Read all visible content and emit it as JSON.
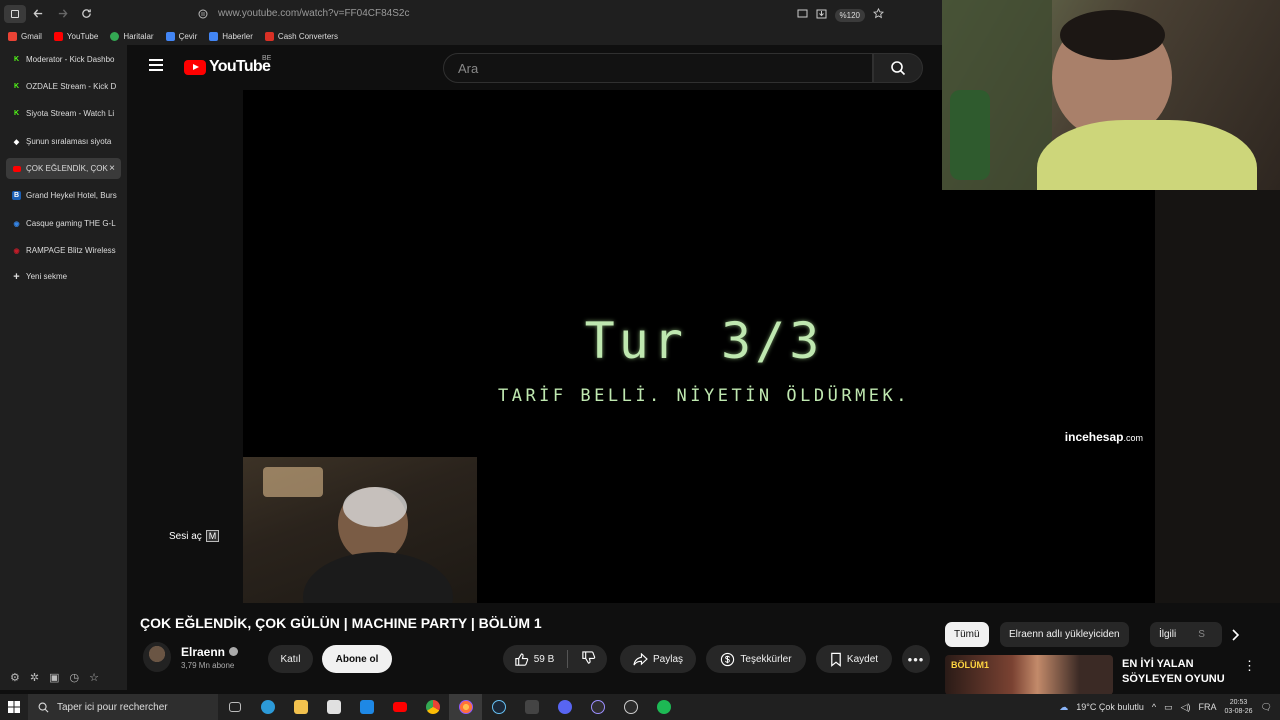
{
  "browser": {
    "url": "www.youtube.com/watch?v=FF04CF84S2c",
    "zoom": "%120",
    "bookmarks": [
      {
        "label": "Gmail",
        "color": "#ea4335"
      },
      {
        "label": "YouTube",
        "color": "#ff0000"
      },
      {
        "label": "Haritalar",
        "color": "#34a853"
      },
      {
        "label": "Çevir",
        "color": "#4285f4"
      },
      {
        "label": "Haberler",
        "color": "#4285f4"
      },
      {
        "label": "Cash Converters",
        "color": "#d93025"
      }
    ],
    "tabs": [
      {
        "label": "Moderator - Kick Dashbo",
        "icon": "kick-icon",
        "color": "#53fc18"
      },
      {
        "label": "OZDALE Stream - Kick D",
        "icon": "kick-icon",
        "color": "#53fc18"
      },
      {
        "label": "Siyota Stream - Watch Li",
        "icon": "kick-icon",
        "color": "#53fc18"
      },
      {
        "label": "Şunun sıralaması siyota",
        "icon": "web-icon",
        "color": "#ffffff"
      },
      {
        "label": "ÇOK EĞLENDİK, ÇOK",
        "icon": "youtube-icon",
        "color": "#ff0000",
        "active": true
      },
      {
        "label": "Grand Heykel Hotel, Burs",
        "icon": "booking-icon",
        "color": "#1a5fb4"
      },
      {
        "label": "Casque gaming THE G-L",
        "icon": "shop-icon",
        "color": "#3584e4"
      },
      {
        "label": "RAMPAGE Blitz Wireless",
        "icon": "shop-icon",
        "color": "#c01c28"
      }
    ],
    "new_tab": "Yeni sekme"
  },
  "youtube": {
    "region": "BE",
    "logo_text": "YouTube",
    "search_placeholder": "Ara"
  },
  "video": {
    "overlay_title": "Tur 3/3",
    "overlay_subtitle": "TARİF BELLİ. NİYETİN ÖLDÜRMEK.",
    "sponsor_bold": "incehesap",
    "sponsor_suffix": ".com",
    "unmute_label": "Sesi aç",
    "unmute_key": "M",
    "title": "ÇOK EĞLENDİK, ÇOK GÜLÜN | MACHINE PARTY | BÖLÜM 1"
  },
  "channel": {
    "name": "Elraenn",
    "subscribers": "3,79 Mn abone",
    "join": "Katıl",
    "subscribe": "Abone ol"
  },
  "actions": {
    "likes": "59 B",
    "share": "Paylaş",
    "thanks": "Teşekkürler",
    "save": "Kaydet"
  },
  "rail": {
    "chips": [
      "Tümü",
      "Elraenn adlı yükleyiciden",
      "İlgili",
      "S"
    ],
    "rec_thumb_label": "BÖLÜM1",
    "rec_title": "EN İYİ YALAN SÖYLEYEN OYUNU ..."
  },
  "taskbar": {
    "search_placeholder": "Taper ici pour rechercher",
    "weather": "19°C  Çok bulutlu",
    "lang": "FRA",
    "time": "20:53",
    "date": "03-08-26",
    "apps": [
      {
        "name": "task-view-icon",
        "color": "#888888"
      },
      {
        "name": "edge-icon",
        "color": "#2c9ad8"
      },
      {
        "name": "explorer-icon",
        "color": "#f2c14e"
      },
      {
        "name": "store-icon",
        "color": "#e0e0e0"
      },
      {
        "name": "mail-icon",
        "color": "#1e88e5"
      },
      {
        "name": "youtube-music-icon",
        "color": "#ff0000"
      },
      {
        "name": "chrome-icon",
        "color": "#fbbc05"
      },
      {
        "name": "firefox-icon",
        "color": "#ff7139",
        "active": true
      },
      {
        "name": "steam-icon",
        "color": "#66c0f4"
      },
      {
        "name": "epic-icon",
        "color": "#444444"
      },
      {
        "name": "discord-icon",
        "color": "#5865f2"
      },
      {
        "name": "obs-icon",
        "color": "#7c6ff5"
      },
      {
        "name": "xbox-icon",
        "color": "#9e9e9e"
      },
      {
        "name": "spotify-icon",
        "color": "#1db954"
      }
    ]
  }
}
